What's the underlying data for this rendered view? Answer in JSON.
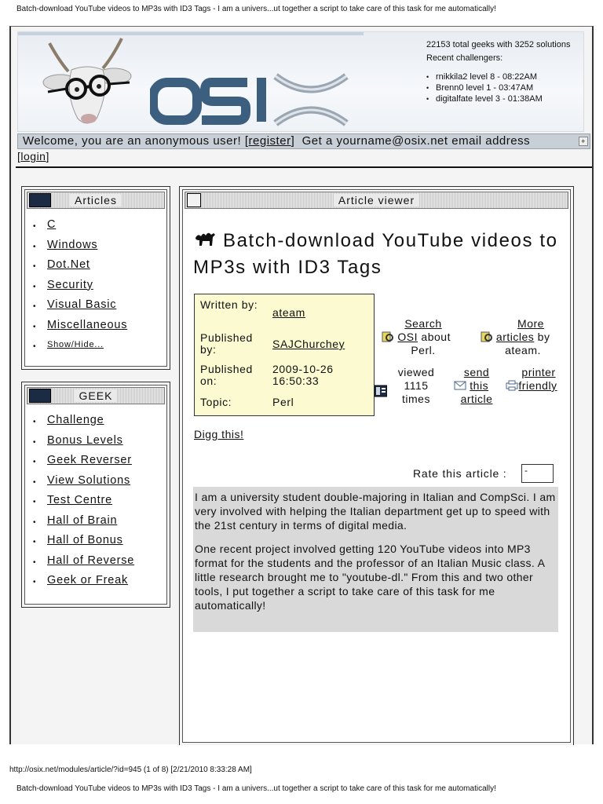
{
  "print": {
    "header": "Batch-download YouTube videos to MP3s with ID3 Tags - I am a univers...ut together a script to take care of this task for me automatically!",
    "footer": "http://osix.net/modules/article/?id=945 (1 of 8) [2/21/2010 8:33:28 AM]",
    "header_next": "Batch-download YouTube videos to MP3s with ID3 Tags - I am a univers...ut together a script to take care of this task for me automatically!"
  },
  "banner": {
    "stats_line": "22153 total geeks with 3252 solutions",
    "recent_label": "Recent challengers:",
    "challengers": [
      "rnikkila2 level 8 - 08:22AM",
      "Brenn0 level 1 - 03:47AM",
      "digitalfate level 3 - 01:38AM"
    ]
  },
  "welcome": {
    "text": "Welcome, you are an anonymous user!",
    "register": "register",
    "email_offer": "Get a yourname@osix.net email address",
    "login": "login",
    "bracket_open": "[",
    "bracket_close": "]"
  },
  "articles_menu": {
    "title": "Articles",
    "items": [
      "C",
      "Windows",
      "Dot.Net",
      "Security",
      "Visual Basic",
      "Miscellaneous"
    ],
    "toggle": "Show/Hide..."
  },
  "geek_menu": {
    "title": "GEEK",
    "items": [
      "Challenge",
      "Bonus Levels",
      "Geek Reverser",
      "View Solutions",
      "Test Centre",
      "Hall of Brain",
      "Hall of Bonus",
      "Hall of Reverse",
      "Geek or Freak"
    ]
  },
  "viewer": {
    "title": "Article viewer",
    "article_title": "Batch-download YouTube videos to MP3s with ID3 Tags",
    "meta": {
      "written_by_label": "Written by:",
      "written_by": "ateam",
      "published_by_label": "Published by:",
      "published_by": "SAJChurchey",
      "published_on_label": "Published on:",
      "published_on": "2009-10-26 16:50:33",
      "topic_label": "Topic:",
      "topic": "Perl"
    },
    "actions": {
      "search_1": "Search",
      "search_2": "OSI",
      "search_3": "about",
      "search_4": "Perl.",
      "more_1": "More",
      "more_2": "articles",
      "more_3": "by",
      "more_4": "ateam.",
      "viewed_1": "viewed",
      "viewed_2": "1115",
      "viewed_3": "times",
      "send_1": "send",
      "send_2": "this",
      "send_3": "article",
      "printer_1": "printer",
      "printer_2": "friendly"
    },
    "digg": "Digg this!",
    "rate_label": "Rate this article :",
    "rate_value": "-",
    "body": [
      "I am a university student double-majoring in Italian and CompSci. I am very involved with helping the Italian department get up to speed with the 21st century in terms of digital media.",
      "One recent project involved getting 120 YouTube videos into MP3 format for the students and the professor of an Italian Music class. A little research brought me to \"youtube-dl.\" From this and two other tools, I put together a script to take care of this task for me automatically!"
    ]
  },
  "colors": {
    "meta_bg": "#fbfad0",
    "body_bg": "#d9d9d9",
    "bar_bg": "#c9cfd6",
    "logo_blue": "#3d5f7f"
  }
}
